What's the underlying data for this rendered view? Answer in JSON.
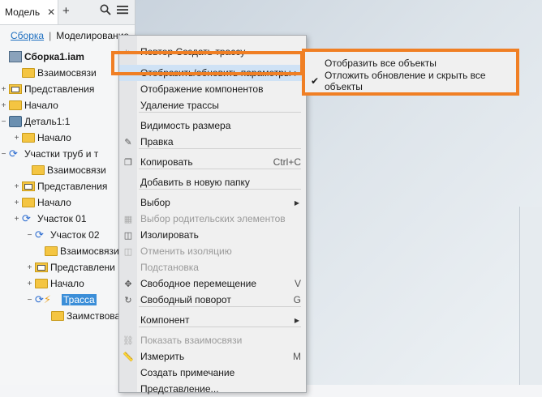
{
  "panel": {
    "tab_label": "Модель",
    "close_glyph": "✕",
    "add_glyph": "+",
    "subtabs": [
      "Сборка",
      "|",
      "Моделирование"
    ]
  },
  "tree": [
    {
      "label": "Сборка1.iam",
      "toggle": "",
      "icon": "asm"
    },
    {
      "label": "Взаимосвязи",
      "toggle": "",
      "icon": "folder"
    },
    {
      "label": "Представления",
      "toggle": "+",
      "icon": "rep"
    },
    {
      "label": "Начало",
      "toggle": "+",
      "icon": "folder"
    },
    {
      "label": "Деталь1:1",
      "toggle": "−",
      "icon": "part"
    },
    {
      "label": "Начало",
      "toggle": "+",
      "icon": "folder"
    },
    {
      "label": "Участки труб и т",
      "toggle": "−",
      "icon": "run"
    },
    {
      "label": "Взаимосвязи",
      "toggle": "",
      "icon": "folder"
    },
    {
      "label": "Представления",
      "toggle": "+",
      "icon": "rep"
    },
    {
      "label": "Начало",
      "toggle": "+",
      "icon": "folder"
    },
    {
      "label": "Участок 01",
      "toggle": "+",
      "icon": "run"
    },
    {
      "label": "Участок 02",
      "toggle": "−",
      "icon": "run"
    },
    {
      "label": "Взаимосвязи",
      "toggle": "",
      "icon": "folder"
    },
    {
      "label": "Представлени",
      "toggle": "+",
      "icon": "rep"
    },
    {
      "label": "Начало",
      "toggle": "+",
      "icon": "folder"
    },
    {
      "label": "Трасса",
      "toggle": "−",
      "icon": "route"
    },
    {
      "label": "Заимствова",
      "toggle": "",
      "icon": "folder"
    }
  ],
  "menu": [
    {
      "label": "Повтор Создать трассу",
      "icon": "route"
    },
    {
      "label": "Отобразить/обновить параметры",
      "arrow": "▶",
      "highlight": true
    },
    {
      "label": "Отображение компонентов"
    },
    {
      "label": "Удаление трассы"
    },
    {
      "label": "Видимость размера"
    },
    {
      "label": "Правка",
      "icon": "edit"
    },
    {
      "label": "Копировать",
      "shortcut": "Ctrl+C",
      "icon": "copy"
    },
    {
      "label": "Добавить в новую папку"
    },
    {
      "label": "Выбор",
      "arrow": "▶"
    },
    {
      "label": "Выбор родительских элементов",
      "disabled": true,
      "icon": "select"
    },
    {
      "label": "Изолировать",
      "icon": "isolate"
    },
    {
      "label": "Отменить изоляцию",
      "disabled": true,
      "icon": "isolate"
    },
    {
      "label": "Подстановка",
      "disabled": true
    },
    {
      "label": "Свободное перемещение",
      "shortcut": "V",
      "icon": "move"
    },
    {
      "label": "Свободный поворот",
      "shortcut": "G",
      "icon": "rotate"
    },
    {
      "label": "Компонент",
      "arrow": "▶"
    },
    {
      "label": "Показать взаимосвязи",
      "disabled": true,
      "icon": "rel"
    },
    {
      "label": "Измерить",
      "shortcut": "M",
      "icon": "measure"
    },
    {
      "label": "Создать примечание"
    },
    {
      "label": "Представление..."
    }
  ],
  "submenu": [
    {
      "label": "Отобразить все объекты",
      "check": ""
    },
    {
      "label": "Отложить обновление и скрыть все объекты",
      "check": "✔"
    }
  ],
  "colors": {
    "accent": "#f07f24",
    "selection": "#3b8ed8"
  }
}
